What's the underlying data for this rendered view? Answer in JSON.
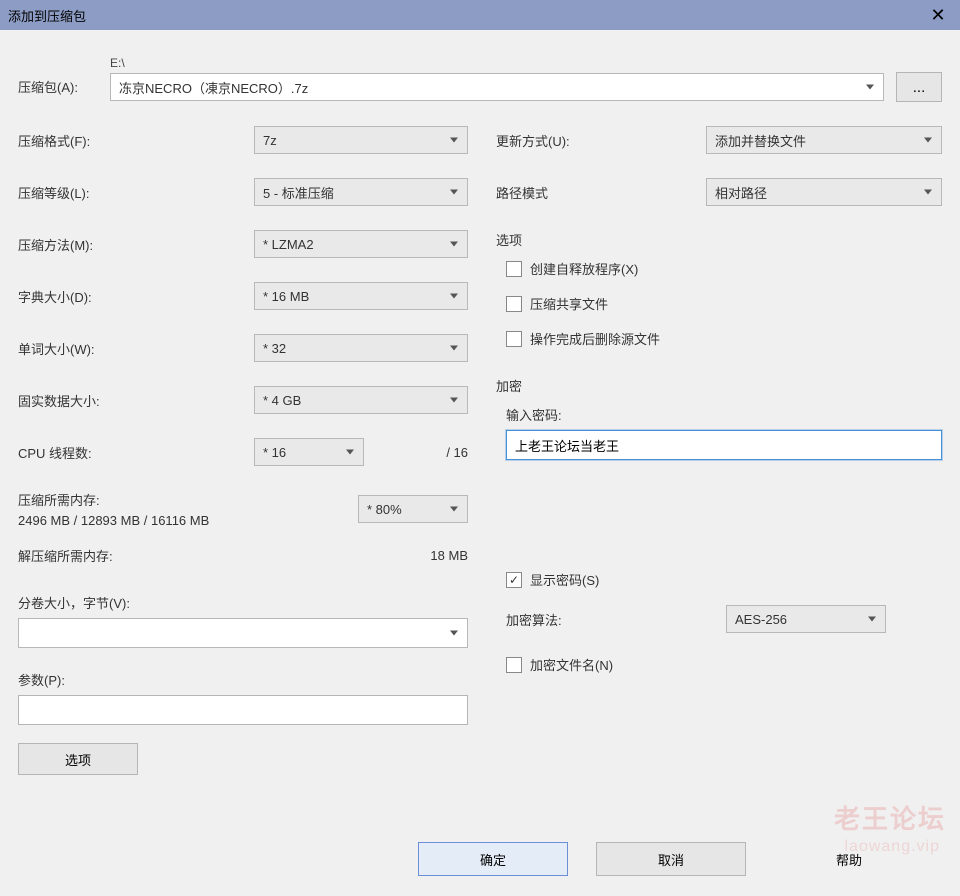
{
  "title": "添加到压缩包",
  "archive": {
    "label": "压缩包(A):",
    "drive": "E:\\",
    "filename": "冻京NECRO（凍京NECRO）.7z",
    "browse": "..."
  },
  "left": {
    "format": {
      "label": "压缩格式(F):",
      "value": "7z"
    },
    "level": {
      "label": "压缩等级(L):",
      "value": "5 - 标准压缩"
    },
    "method": {
      "label": "压缩方法(M):",
      "value": "* LZMA2"
    },
    "dict": {
      "label": "字典大小(D):",
      "value": "* 16 MB"
    },
    "word": {
      "label": "单词大小(W):",
      "value": "* 32"
    },
    "solid": {
      "label": "固实数据大小:",
      "value": "* 4 GB"
    },
    "cpu": {
      "label": "CPU 线程数:",
      "value": "* 16",
      "total": "/ 16"
    },
    "memComp": {
      "label": "压缩所需内存:",
      "value": "2496 MB / 12893 MB / 16116 MB",
      "pct": "* 80%"
    },
    "memDecomp": {
      "label": "解压缩所需内存:",
      "value": "18 MB"
    },
    "split": {
      "label": "分卷大小，字节(V):"
    },
    "params": {
      "label": "参数(P):"
    },
    "optionsBtn": "选项"
  },
  "right": {
    "update": {
      "label": "更新方式(U):",
      "value": "添加并替换文件"
    },
    "pathmode": {
      "label": "路径模式",
      "value": "相对路径"
    },
    "optionsTitle": "选项",
    "opt_sfx": "创建自释放程序(X)",
    "opt_shared": "压缩共享文件",
    "opt_delsrc": "操作完成后删除源文件",
    "encTitle": "加密",
    "pwdLabel": "输入密码:",
    "pwdValue": "上老王论坛当老王",
    "showpwd": "显示密码(S)",
    "encMethod": {
      "label": "加密算法:",
      "value": "AES-256"
    },
    "encNames": "加密文件名(N)"
  },
  "buttons": {
    "ok": "确定",
    "cancel": "取消",
    "help": "帮助"
  },
  "watermark": {
    "a": "老王论坛",
    "b": "laowang.vip"
  }
}
